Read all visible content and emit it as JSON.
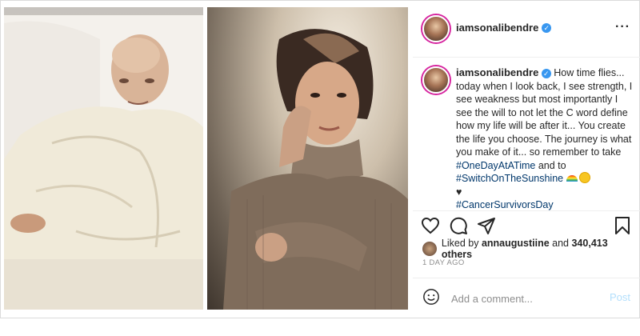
{
  "post": {
    "username": "iamsonalibendre",
    "caption": {
      "text_1": "How time flies... today when I look back, I see strength, I see weakness but most importantly I see the will to not let the C word define how my life will be after it... You create the life you choose. The journey is what you make of it... so remember to take ",
      "hashtag_1": "#OneDayAtATime",
      "text_2": " and to ",
      "hashtag_2": "#SwitchOnTheSunshine",
      "heart": "♥",
      "hashtag_3": "#CancerSurvivorsDay"
    },
    "likes": {
      "prefix": "Liked by ",
      "user": "annaugustiine",
      "middle": " and ",
      "count": "340,413 others"
    },
    "time_ago": "1 DAY AGO",
    "comment": {
      "placeholder": "Add a comment...",
      "post_label": "Post"
    },
    "more_label": "···"
  },
  "icons": [
    "heart-icon",
    "comment-icon",
    "share-icon",
    "bookmark-icon",
    "emoji-icon",
    "verified-icon"
  ],
  "colors": {
    "hashtag": "#00376b",
    "verified": "#3897f0",
    "post_disabled": "#b2dffc",
    "muted": "#8e8e8e"
  }
}
